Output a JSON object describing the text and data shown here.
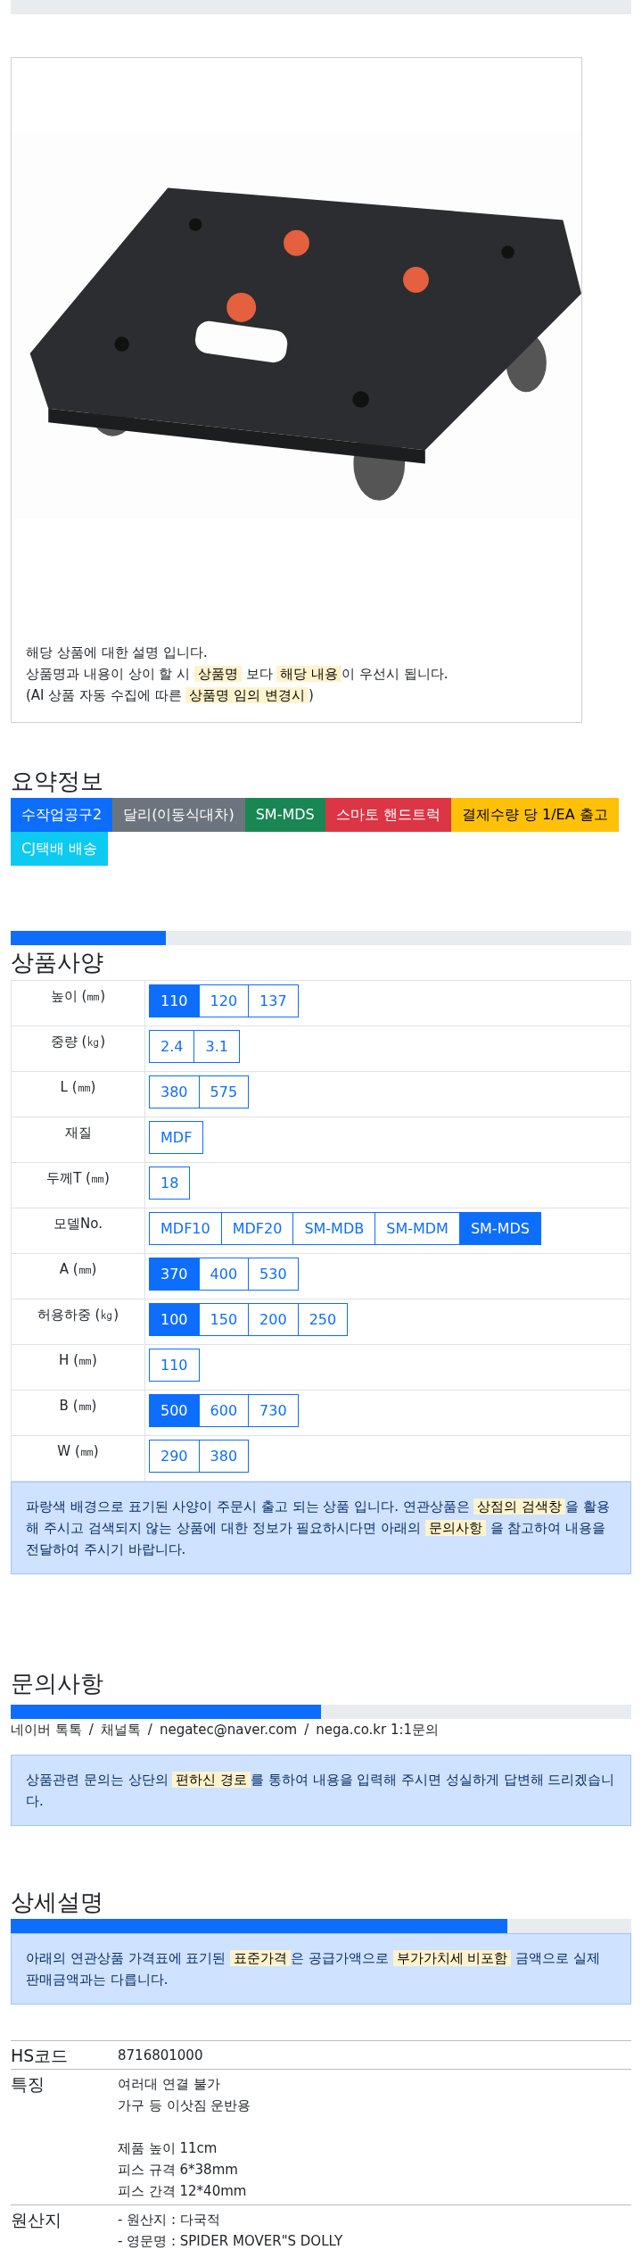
{
  "top_progress": {
    "level": 0
  },
  "product_card": {
    "image": {
      "kind": "picture"
    },
    "lines": [
      [
        {
          "text": "해당 상품에 대한 설명 입니다.",
          "highlight": false
        }
      ],
      [
        {
          "text": "상품명과 내용이 상이 할 시 ",
          "highlight": false
        },
        {
          "text": "상품명",
          "highlight": true
        },
        {
          "text": " 보다 ",
          "highlight": false
        },
        {
          "text": "해당 내용",
          "highlight": true
        },
        {
          "text": "이 우선시 됩니다.",
          "highlight": false
        }
      ],
      [
        {
          "text": "(AI 상품 자동 수집에 따른 ",
          "highlight": false
        },
        {
          "text": "상품명 임의 변경시",
          "highlight": true
        },
        {
          "text": ")",
          "highlight": false
        }
      ]
    ]
  },
  "summary": {
    "title": "요약정보",
    "badges": [
      {
        "label": "수작업공구2",
        "color": "#0d6efd"
      },
      {
        "label": "달리(이동식대차)",
        "color": "#6c757d"
      },
      {
        "label": "SM-MDS",
        "color": "#198754"
      },
      {
        "label": "스마토 핸드트럭",
        "color": "#dc3545"
      },
      {
        "label": "결제수량 당 1/EA 출고",
        "color": "#ffc107"
      },
      {
        "label": "CJ택배 배송",
        "color": "#0dcaf0"
      }
    ]
  },
  "specs": {
    "progress": {
      "level": 0.25
    },
    "title": "상품사양",
    "rows": [
      {
        "label": "높이 (㎜)",
        "options": [
          {
            "label": "110",
            "selected": true
          },
          {
            "label": "120",
            "selected": false
          },
          {
            "label": "137",
            "selected": false
          }
        ]
      },
      {
        "label": "중량 (㎏)",
        "options": [
          {
            "label": "2.4",
            "selected": false
          },
          {
            "label": "3.1",
            "selected": false
          }
        ]
      },
      {
        "label": "L (㎜)",
        "options": [
          {
            "label": "380",
            "selected": false
          },
          {
            "label": "575",
            "selected": false
          }
        ]
      },
      {
        "label": "재질",
        "options": [
          {
            "label": "MDF",
            "selected": false
          }
        ]
      },
      {
        "label": "두께T (㎜)",
        "options": [
          {
            "label": "18",
            "selected": false
          }
        ]
      },
      {
        "label": "모델No.",
        "options": [
          {
            "label": "MDF10",
            "selected": false
          },
          {
            "label": "MDF20",
            "selected": false
          },
          {
            "label": "SM-MDB",
            "selected": false
          },
          {
            "label": "SM-MDM",
            "selected": false
          },
          {
            "label": "SM-MDS",
            "selected": true
          }
        ]
      },
      {
        "label": "A (㎜)",
        "options": [
          {
            "label": "370",
            "selected": true
          },
          {
            "label": "400",
            "selected": false
          },
          {
            "label": "530",
            "selected": false
          }
        ]
      },
      {
        "label": "허용하중 (㎏)",
        "options": [
          {
            "label": "100",
            "selected": true
          },
          {
            "label": "150",
            "selected": false
          },
          {
            "label": "200",
            "selected": false
          },
          {
            "label": "250",
            "selected": false
          }
        ]
      },
      {
        "label": "H (㎜)",
        "options": [
          {
            "label": "110",
            "selected": false
          }
        ]
      },
      {
        "label": "B (㎜)",
        "options": [
          {
            "label": "500",
            "selected": true
          },
          {
            "label": "600",
            "selected": false
          },
          {
            "label": "730",
            "selected": false
          }
        ]
      },
      {
        "label": "W (㎜)",
        "options": [
          {
            "label": "290",
            "selected": false
          },
          {
            "label": "380",
            "selected": false
          }
        ]
      }
    ],
    "note": [
      {
        "text": "파랑색 배경으로 표기된 사양이 주문시 출고 되는 상품 입니다. 연관상품은 ",
        "highlight": false
      },
      {
        "text": "상점의 검색창",
        "highlight": true
      },
      {
        "text": "을 활용해 주시고 검색되지 않는 상품에 대한 정보가 필요하시다면 아래의 ",
        "highlight": false
      },
      {
        "text": "문의사항",
        "highlight": true
      },
      {
        "text": " 을 참고하여 내용을 전달하여 주시기 바랍니다.",
        "highlight": false
      }
    ]
  },
  "inquiry": {
    "title": "문의사항",
    "progress": {
      "level": 0.5
    },
    "contacts": [
      "네이버 톡톡",
      "채널톡",
      "negatec@naver.com",
      "nega.co.kr 1:1문의"
    ],
    "separators": [
      "/",
      "/",
      "/"
    ],
    "note": [
      {
        "text": "상품관련 문의는 상단의 ",
        "highlight": false
      },
      {
        "text": "편하신 경로",
        "highlight": true
      },
      {
        "text": "를 통하여 내용을 입력해 주시면 성실하게 답변해 드리겠습니다.",
        "highlight": false
      }
    ]
  },
  "detail": {
    "title": "상세설명",
    "progress": {
      "level": 0.8
    },
    "note": [
      {
        "text": "아래의 연관상품 가격표에 표기된 ",
        "highlight": false
      },
      {
        "text": "표준가격",
        "highlight": true
      },
      {
        "text": "은 공급가액으로 ",
        "highlight": false
      },
      {
        "text": "부가가치세 비포함",
        "highlight": true
      },
      {
        "text": " 금액으로 실제 판매금액과는 다릅니다.",
        "highlight": false
      }
    ],
    "rows": [
      {
        "label": "HS코드",
        "paragraphs": [
          [
            "8716801000"
          ]
        ]
      },
      {
        "label": "특징",
        "paragraphs": [
          [
            "여러대 연결 불가",
            "가구 등 이삿짐 운반용"
          ],
          [
            "제품 높이 11cm",
            "피스 규격 6*38mm",
            "피스 간격 12*40mm"
          ]
        ]
      },
      {
        "label": "원산지",
        "paragraphs": [
          [
            "- 원산지 : 다국적",
            "- 영문명 : SPIDER MOVER\"S DOLLY"
          ]
        ]
      }
    ]
  }
}
